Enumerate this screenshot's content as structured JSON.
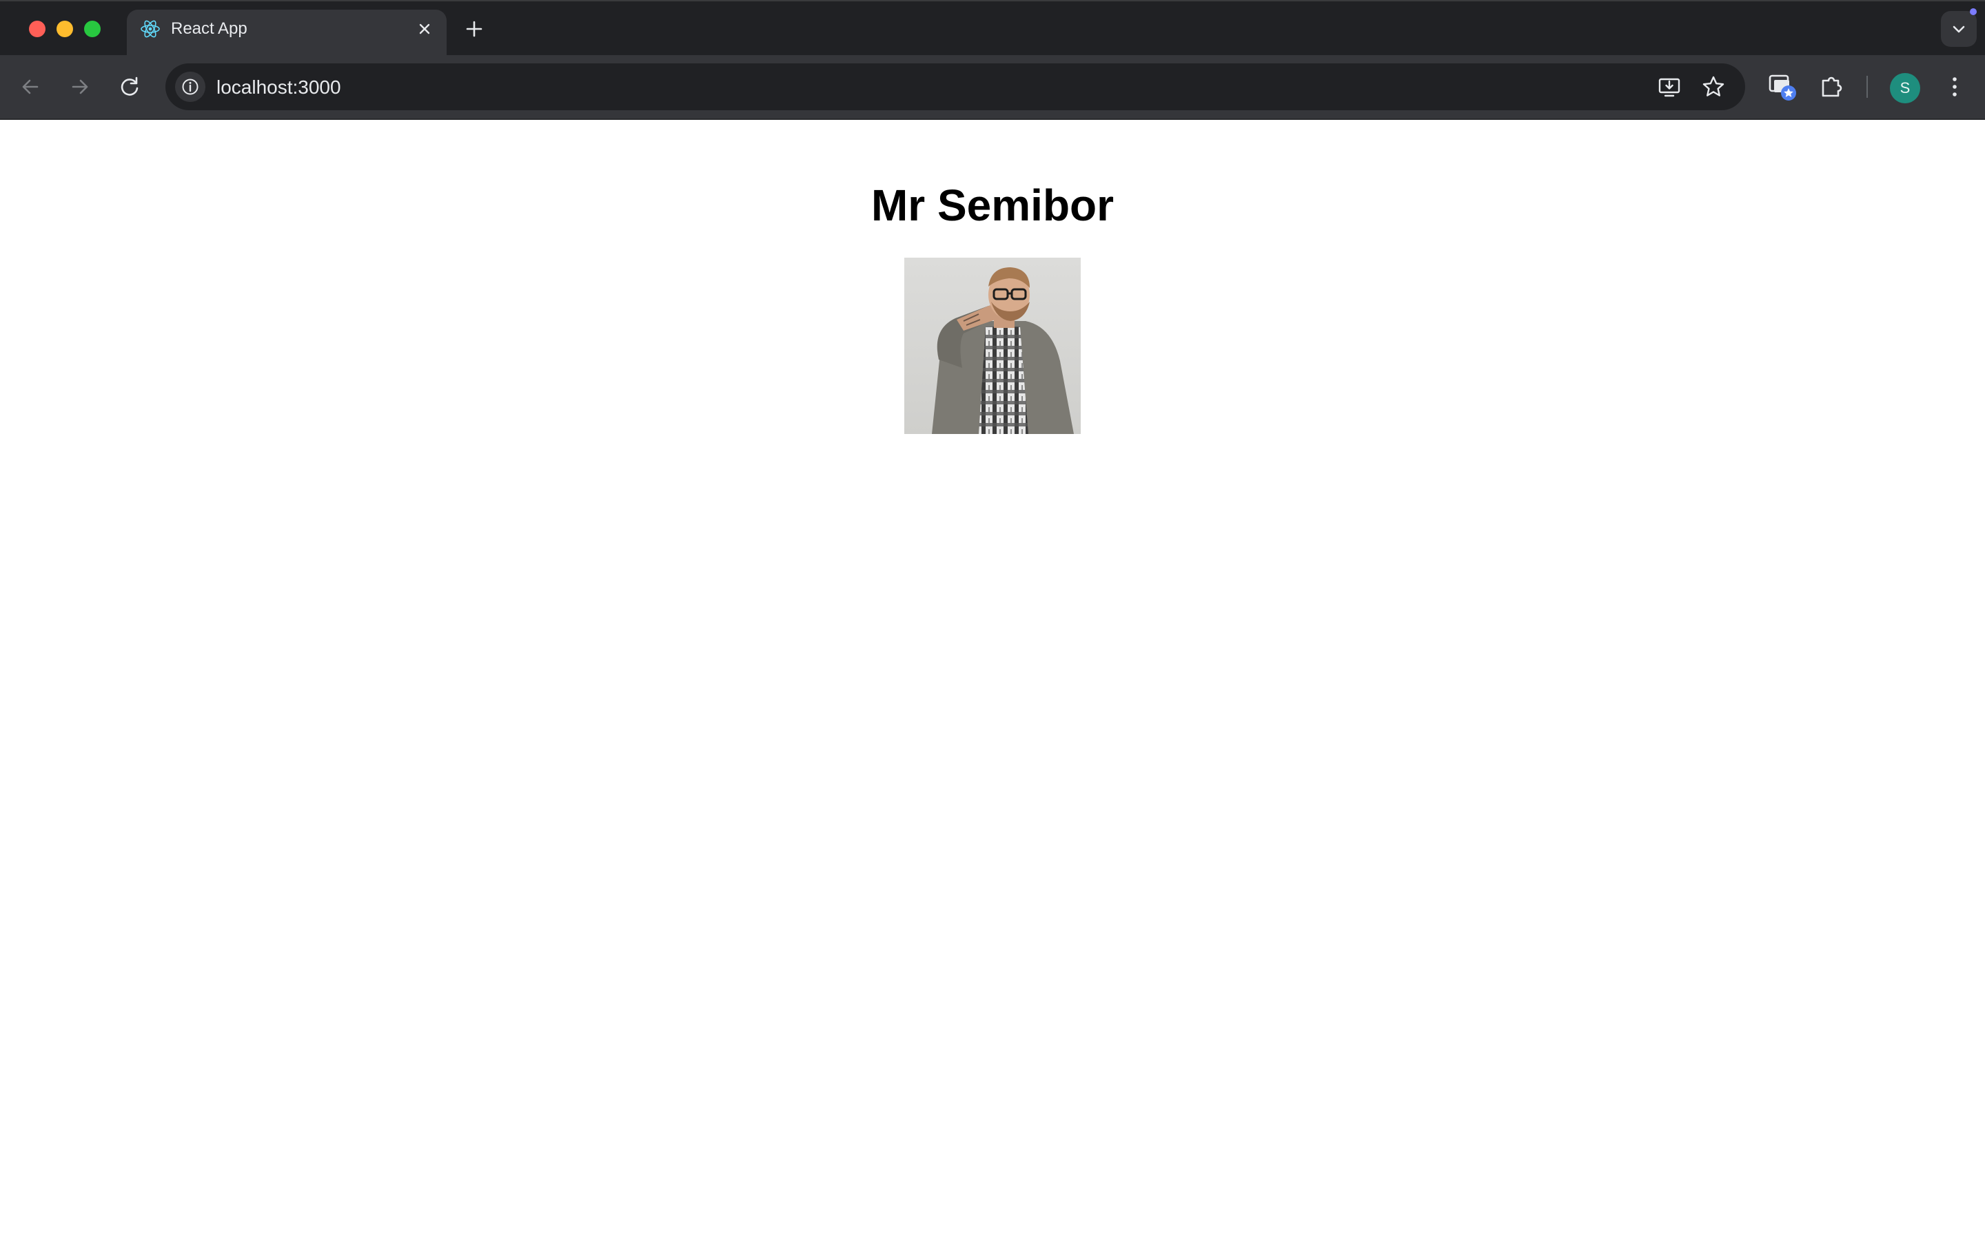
{
  "browser": {
    "tab": {
      "title": "React App",
      "favicon": "react-logo-icon"
    },
    "address_bar": {
      "url": "localhost:3000"
    },
    "profile": {
      "initial": "S",
      "color": "#1e8e7e"
    },
    "icons": [
      "back-arrow-icon",
      "forward-arrow-icon",
      "reload-icon",
      "info-icon",
      "install-app-icon",
      "star-icon",
      "extension-icon",
      "puzzle-icon",
      "more-vertical-icon",
      "plus-icon",
      "close-icon",
      "chevron-down-icon"
    ]
  },
  "page": {
    "heading": "Mr Semibor",
    "photo": {
      "subject": "profile-photo"
    }
  }
}
